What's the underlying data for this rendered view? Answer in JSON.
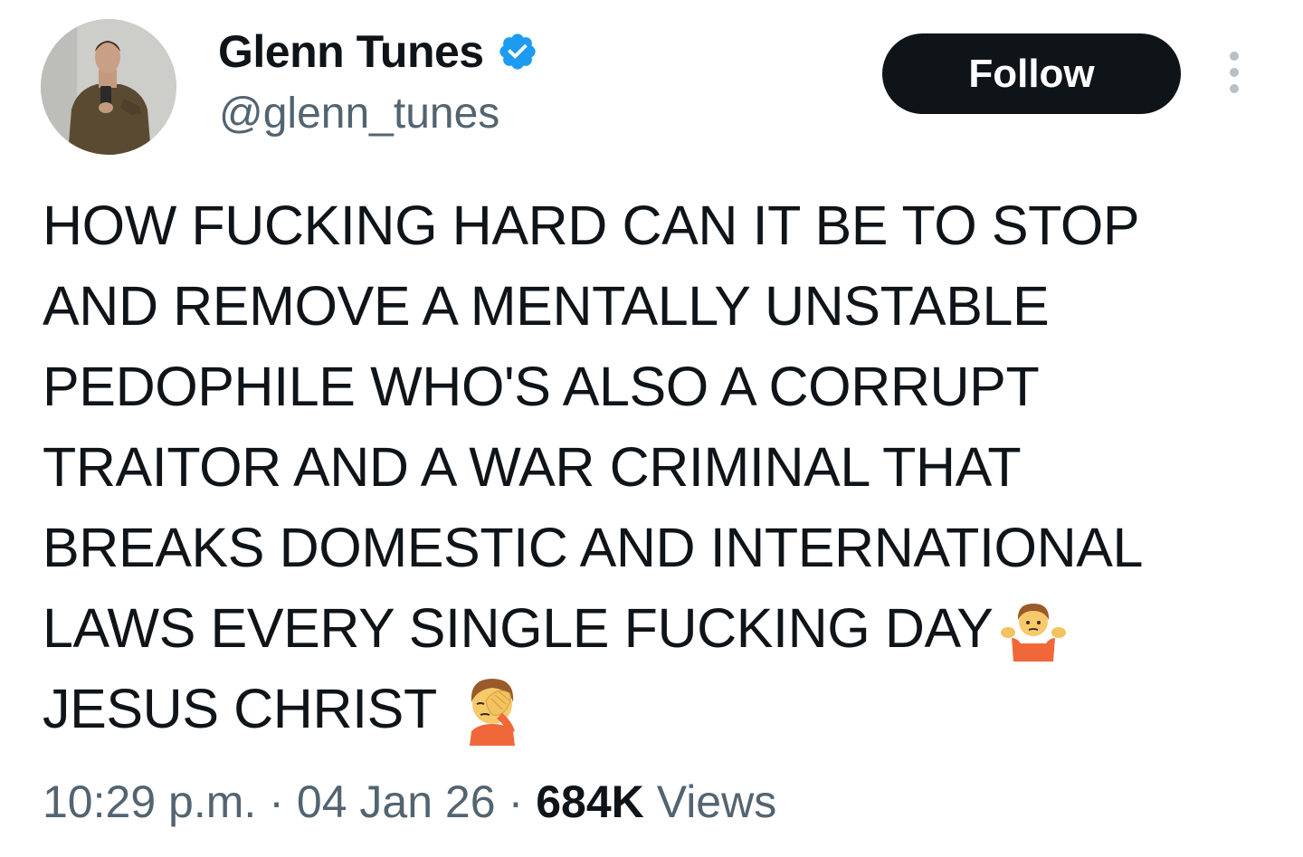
{
  "author": {
    "display_name": "Glenn Tunes",
    "handle": "@glenn_tunes",
    "verified": true,
    "verified_color": "#1d9bf0"
  },
  "follow_button": {
    "label": "Follow"
  },
  "tweet": {
    "lines": [
      "HOW FUCKING HARD CAN IT BE TO STOP",
      "AND REMOVE A MENTALLY UNSTABLE",
      "PEDOPHILE WHO'S ALSO A CORRUPT",
      "TRAITOR AND A WAR CRIMINAL THAT",
      "BREAKS DOMESTIC AND INTERNATIONAL",
      "LAWS EVERY SINGLE FUCKING DAY",
      "JESUS CHRIST"
    ],
    "emojis": {
      "line6": "shrug-emoji",
      "line7": "facepalm-emoji"
    }
  },
  "meta": {
    "time": "10:29 p.m.",
    "separator": "·",
    "date": "04 Jan 26",
    "views_count": "684K",
    "views_label": "Views"
  },
  "colors": {
    "text": "#0f1419",
    "secondary": "#536471",
    "button_bg": "#0f1419",
    "button_text": "#ffffff"
  }
}
